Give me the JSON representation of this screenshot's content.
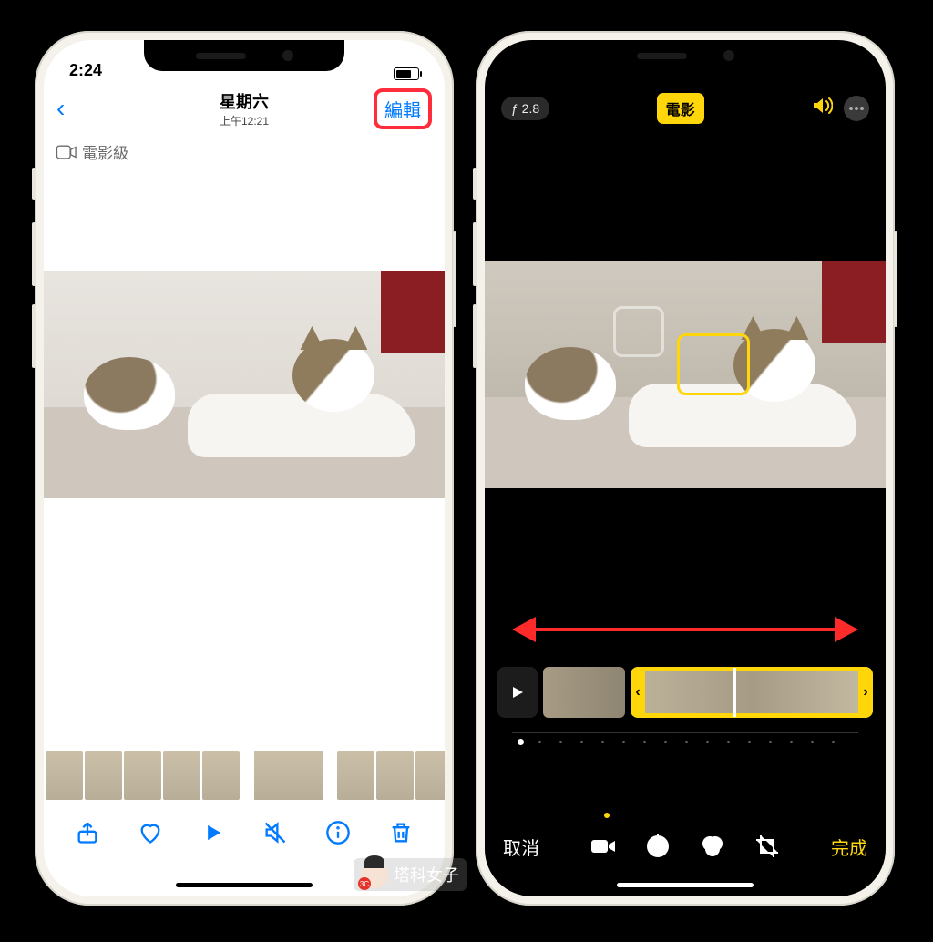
{
  "watermark": {
    "text": "塔科女子",
    "badge": "3C"
  },
  "phone1": {
    "statusbar": {
      "time": "2:24"
    },
    "nav": {
      "title": "星期六",
      "subtitle": "上午12:21",
      "edit_label": "編輯"
    },
    "cinematic_tag": "電影級",
    "highlight_color": "#ff2d3b",
    "toolbar_icons": [
      "share",
      "heart",
      "play",
      "mute",
      "info",
      "trash"
    ]
  },
  "phone2": {
    "top": {
      "aperture": "ƒ 2.8",
      "mode_label": "電影"
    },
    "arrow_color": "#ff2a2a",
    "trim_color": "#ffd60a",
    "bottom": {
      "cancel": "取消",
      "done": "完成"
    },
    "edit_tools": [
      "video",
      "adjust",
      "filters",
      "crop"
    ]
  }
}
